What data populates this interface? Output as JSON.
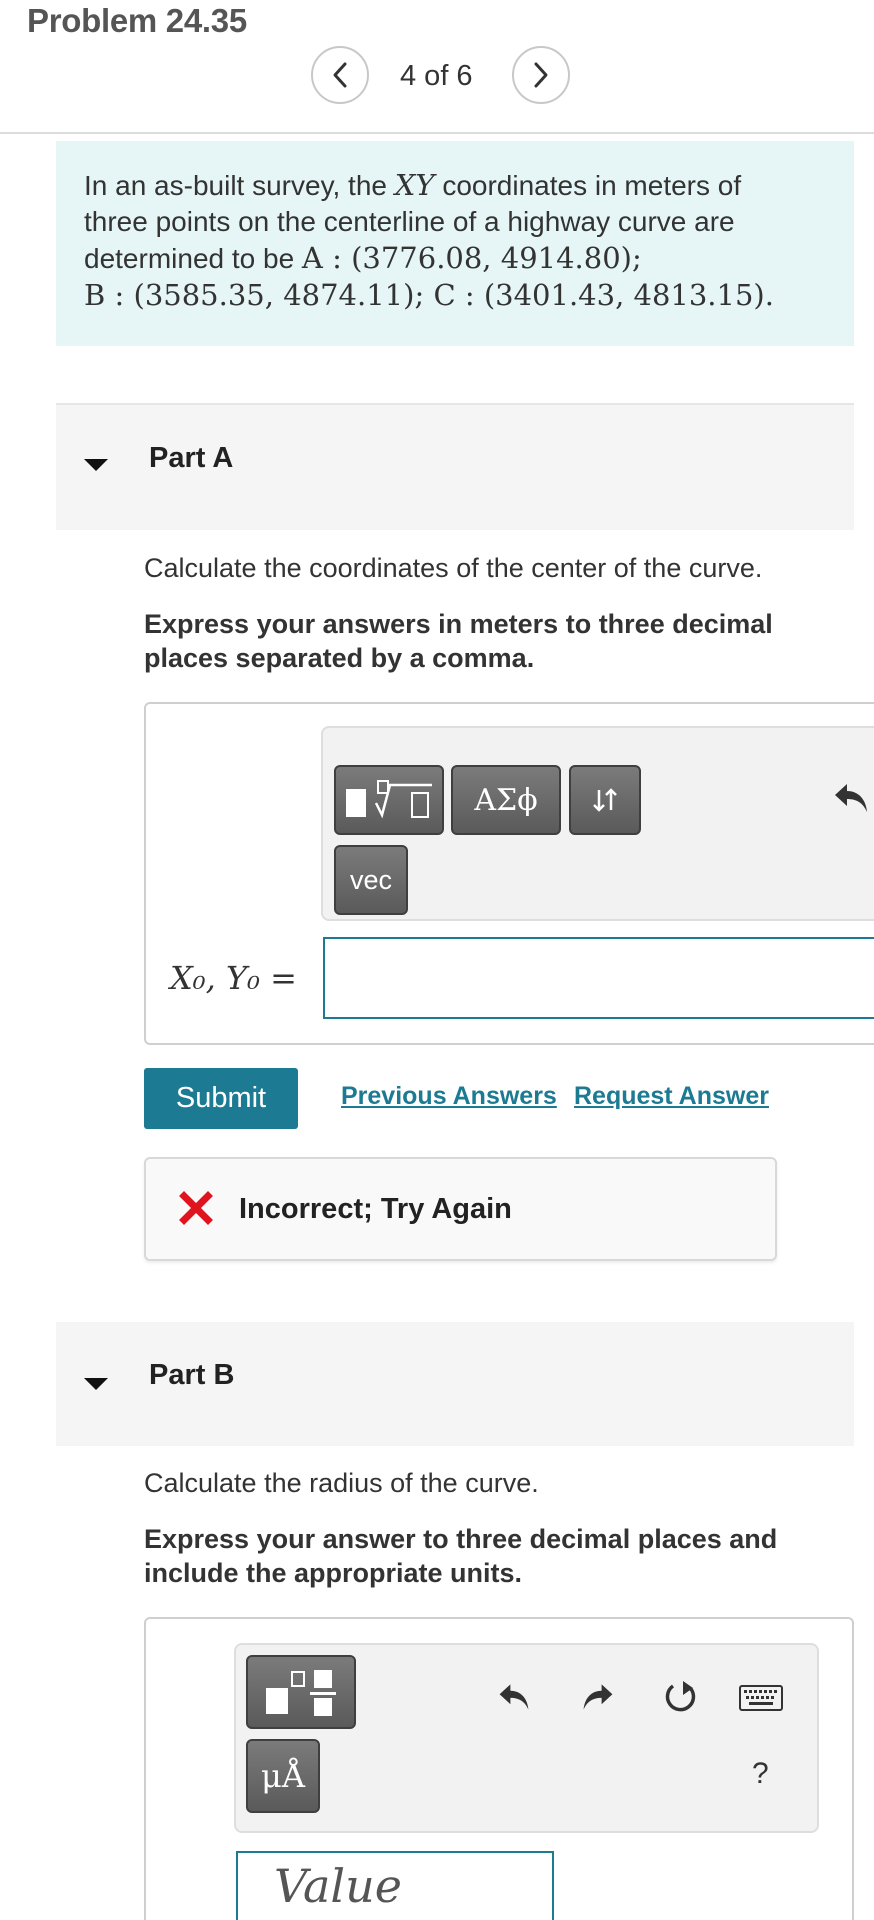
{
  "header": {
    "title": "Problem 24.35",
    "pager": "4 of 6"
  },
  "statement": {
    "line1_text": "In an as-built survey, the ",
    "line1_math": "XY",
    "line1_rest": " coordinates in meters of",
    "line2": "three points on the centerline of a highway curve are",
    "line3_text": "determined to be ",
    "point_a": "A : (3776.08, 4914.80)",
    "point_b": "B : (3585.35, 4874.11)",
    "point_c": "C : (3401.43, 4813.15)"
  },
  "partA": {
    "label": "Part A",
    "question": "Calculate the coordinates of the center of the curve.",
    "instruction": "Express your answers in meters to three decimal places separated by a comma.",
    "greek_label": "ΑΣϕ",
    "vec_label": "vec",
    "answer_label": "X₀, Y₀ =",
    "answer_value": "",
    "submit_label": "Submit",
    "previous_answers_label": "Previous Answers",
    "request_answer_label": "Request Answer",
    "feedback": "Incorrect; Try Again",
    "icons": [
      "template-icon",
      "sqrt-icon",
      "updown-arrows-icon",
      "undo-icon"
    ]
  },
  "partB": {
    "label": "Part B",
    "question": "Calculate the radius of the curve.",
    "instruction": "Express your answer to three decimal places and include the appropriate units.",
    "units_label": "μÅ",
    "input_placeholder": "Value",
    "help_label": "?",
    "icons": [
      "fraction-template-icon",
      "undo-icon",
      "redo-icon",
      "reset-icon",
      "keyboard-icon"
    ]
  },
  "colors": {
    "accent": "#1d7a93",
    "statement_bg": "#e6f6f6",
    "error": "#e0141e"
  }
}
